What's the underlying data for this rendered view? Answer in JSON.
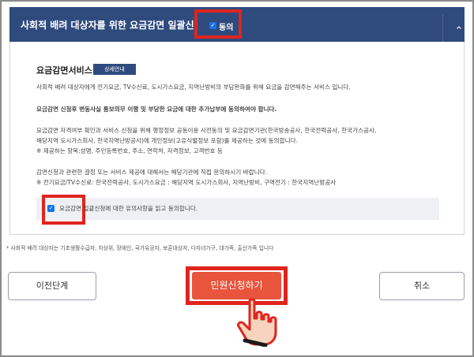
{
  "header": {
    "title": "사회적 배려 대상자를 위한 요금감면 일괄신청",
    "agree_label": "동의",
    "collapse_icon": "chevron-up-icon"
  },
  "service": {
    "title": "요금감면서비스",
    "detail_button": "상세안내",
    "paragraphs": [
      "사회적 배려 대상자에게 전기요금, TV수신료, 도시가스요금, 지역난방비의 부담완화를 위해 요금을 감면해주는 서비스 입니다.",
      "요금감면 신청후 변동사실 통보의무 이행 및 부당한 요금에 대한 추가납부에 동의하여야 합니다.",
      "요금감면 자격여부 확인과 서비스 신청을 위해 행정정보 공동이용 사전동의 및 요금감면기관(한국방송공사, 한국전력공사, 한국가스공사,",
      "해당지역 도시가스회사, 한국지역난방공사)에 개인정보(고유식별정보 포함)를 제공하는 것에 동의합니다.",
      "※ 제공하는 항목:성명, 주민등록번호, 주소, 연락처, 자격정보, 고객번호 등",
      "감면신청과 관련한 결정 또는 서비스 제공에 대해서는 해당기관에 직접 문의하시기 바랍니다.",
      "※ 전기요금/TV수신료: 한국전력공사, 도시가스요금 : 해당지역 도시가스회사, 지역난방비, 구역전기 : 한국지역난방공사"
    ],
    "consent_label": "요금감면 일괄신청에 대한 유의사항을 읽고 동의합니다."
  },
  "footnote": "* 사회적 배려 대상자는 기초생활수급자, 차상위, 장애인, 국가유공자, 보훈대상자, 다자녀가구, 대가족, 출산가족 입니다",
  "buttons": {
    "prev": "이전단계",
    "submit": "민원신청하기",
    "cancel": "취소"
  },
  "colors": {
    "header_bg": "#2f4b7e",
    "highlight": "#e0241d",
    "submit_bg": "#e8543c"
  }
}
